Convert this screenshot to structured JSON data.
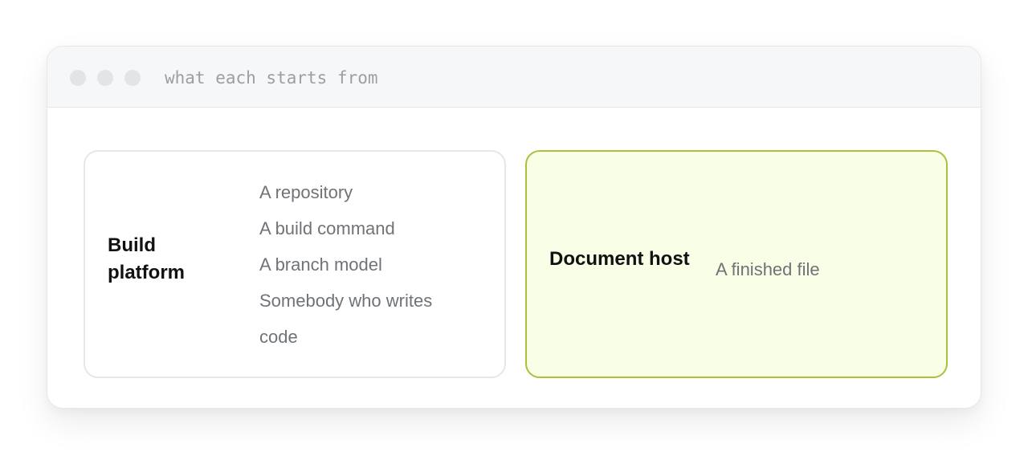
{
  "window": {
    "title": "what each starts from"
  },
  "cards": {
    "build": {
      "title": "Build platform",
      "items": [
        "A repository",
        "A build command",
        "A branch model",
        "Somebody who writes code"
      ]
    },
    "document": {
      "title": "Document host",
      "items": [
        "A finished file"
      ]
    }
  },
  "colors": {
    "accent_border": "#a9c23a",
    "accent_fill": "#f9fee6",
    "titlebar": "#f6f7f8",
    "muted_text": "#6f7378"
  }
}
